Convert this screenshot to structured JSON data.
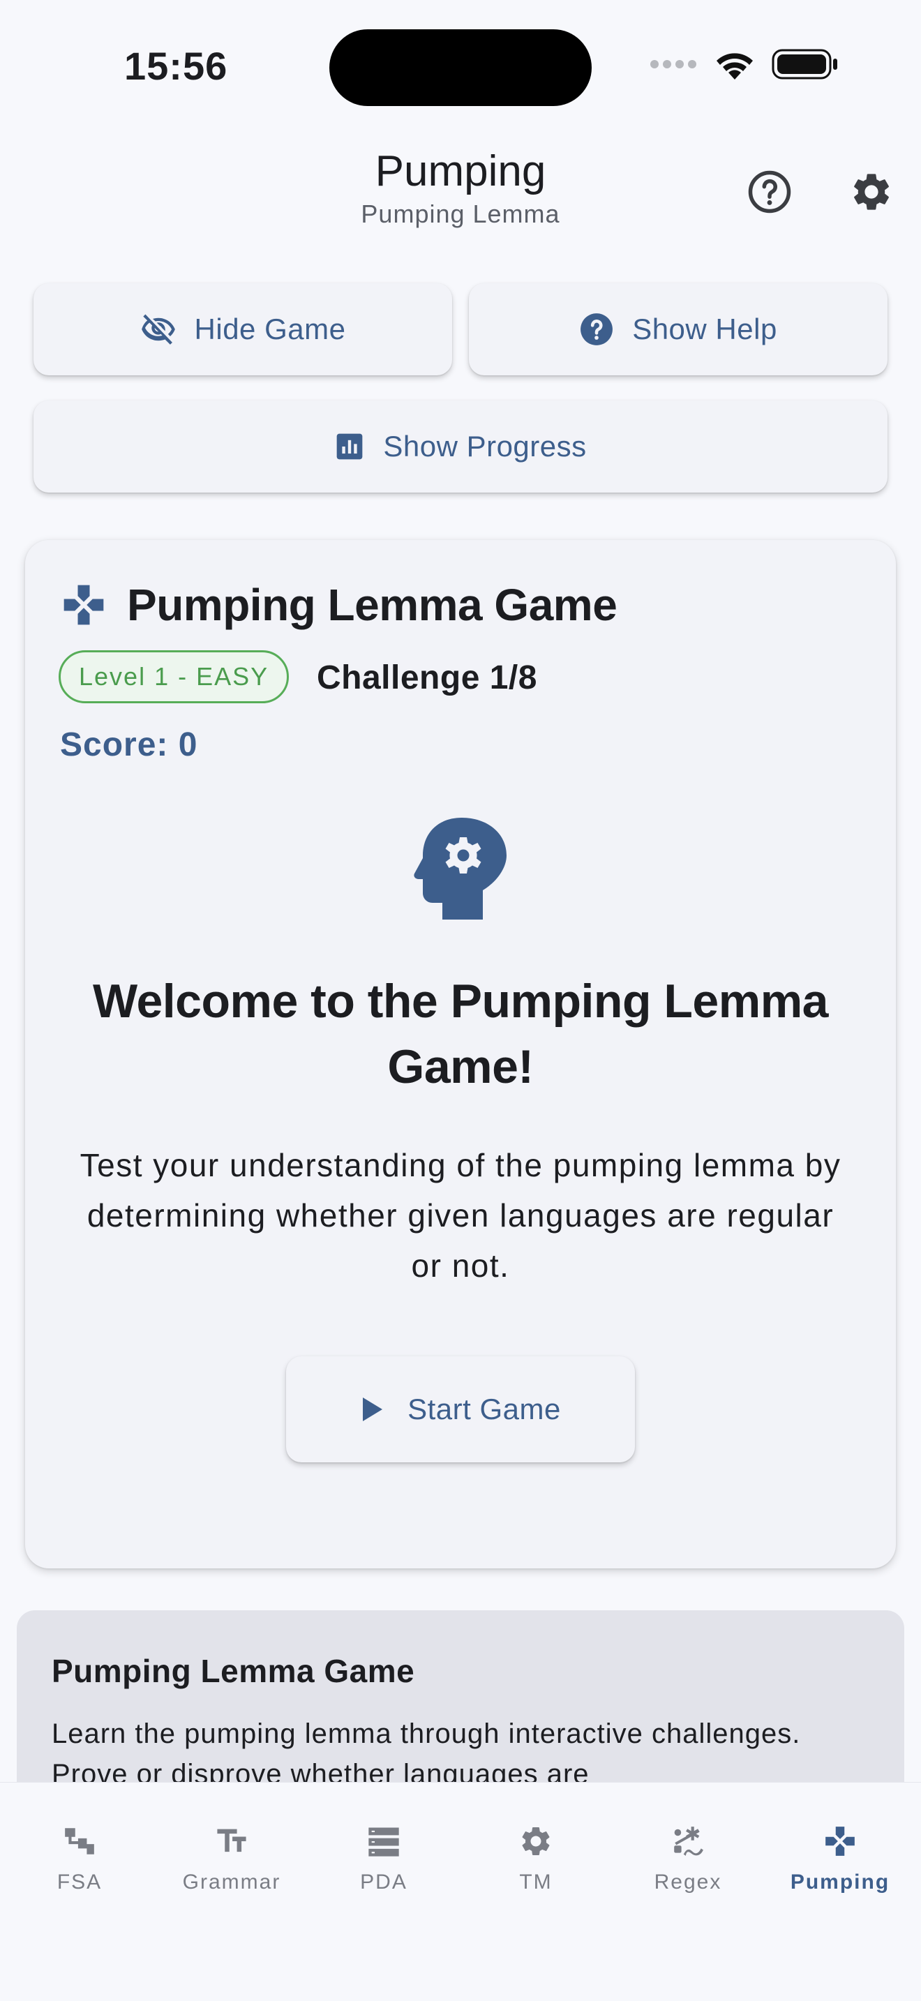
{
  "status_bar": {
    "time": "15:56"
  },
  "app_bar": {
    "title": "Pumping",
    "subtitle": "Pumping Lemma",
    "help_icon": "help-circle-outline-icon",
    "settings_icon": "gear-icon"
  },
  "controls": {
    "hide_game_label": "Hide Game",
    "show_help_label": "Show Help",
    "show_progress_label": "Show Progress"
  },
  "game": {
    "title": "Pumping Lemma Game",
    "level_badge": "Level 1 - EASY",
    "challenge": "Challenge 1/8",
    "score": "Score: 0",
    "welcome_title": "Welcome to the Pumping Lemma Game!",
    "intro_text": "Test your understanding of the pumping lemma by determining whether given languages are regular or not.",
    "start_label": "Start Game"
  },
  "info_card": {
    "title": "Pumping Lemma Game",
    "text": "Learn the pumping lemma through interactive challenges. Prove or disprove whether languages are"
  },
  "bottom_nav": {
    "items": [
      {
        "label": "FSA",
        "icon": "fsa-icon"
      },
      {
        "label": "Grammar",
        "icon": "text-fields-icon"
      },
      {
        "label": "PDA",
        "icon": "stack-icon"
      },
      {
        "label": "TM",
        "icon": "gear-icon"
      },
      {
        "label": "Regex",
        "icon": "regex-icon"
      },
      {
        "label": "Pumping",
        "icon": "gamepad-icon",
        "active": true
      }
    ]
  },
  "colors": {
    "accent": "#3d5e8c",
    "background": "#f7f8fc",
    "card": "#f2f3f8",
    "success": "#4a9c4d"
  }
}
